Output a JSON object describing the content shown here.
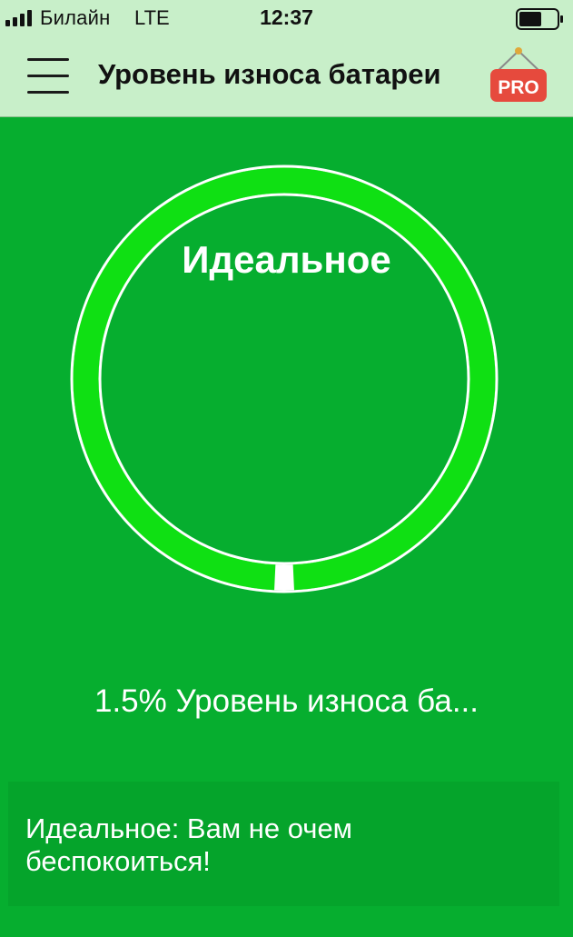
{
  "status_bar": {
    "carrier": "Билайн",
    "network": "LTE",
    "time": "12:37",
    "signal_bars": 4,
    "battery_level": 0.6
  },
  "header": {
    "title": "Уровень износа батареи",
    "menu_icon": "hamburger-menu-icon",
    "pro_badge": "PRO"
  },
  "gauge": {
    "label": "Идеальное",
    "fill_fraction": 0.985,
    "ring_color": "#0fe013",
    "background_color": "#06ae2f"
  },
  "wear_text": "1.5% Уровень износа ба...",
  "message": "Идеальное: Вам не очем беспокоиться!",
  "colors": {
    "topbar": "#c8efc9",
    "pro_red": "#e64a3d"
  }
}
